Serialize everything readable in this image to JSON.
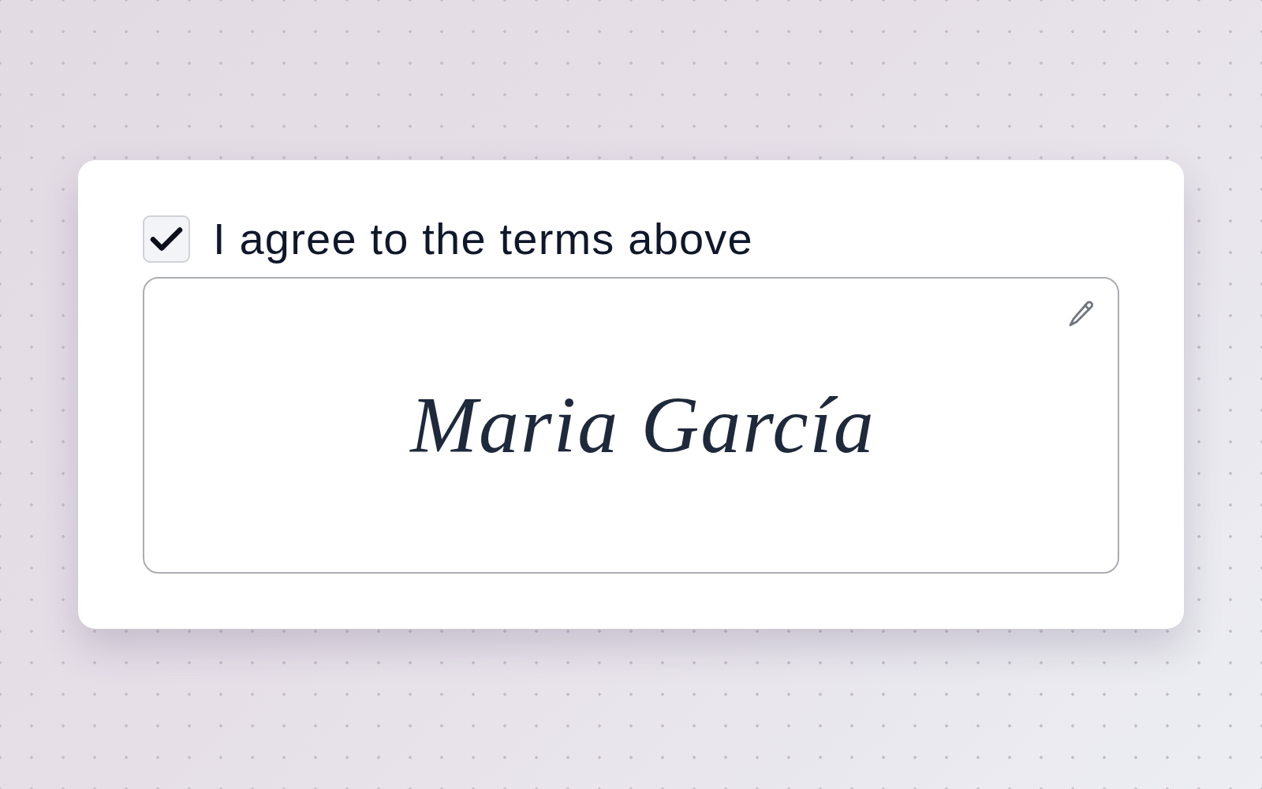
{
  "consent": {
    "label": "I agree to the terms above",
    "checked": true
  },
  "signature_pad": {
    "signature": "Maria García"
  }
}
